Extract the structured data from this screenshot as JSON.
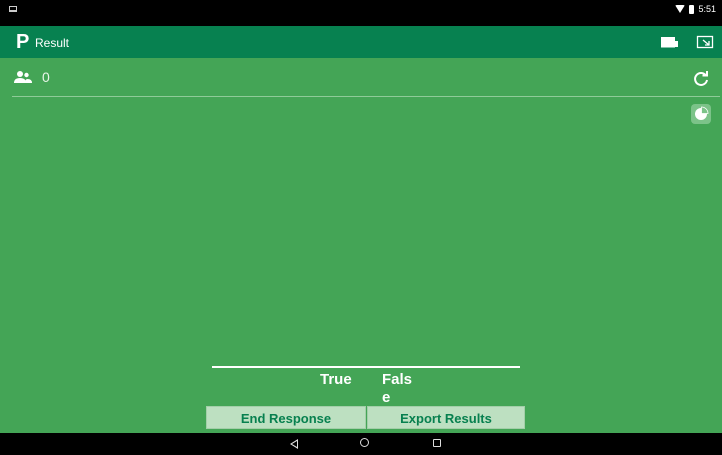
{
  "status_bar": {
    "time": "5:51"
  },
  "app_bar": {
    "logo": "P",
    "title": "Result"
  },
  "summary": {
    "respondent_count": "0"
  },
  "chart_data": {
    "type": "bar",
    "categories": [
      "True",
      "False"
    ],
    "values": [
      0,
      0
    ]
  },
  "actions": {
    "end_response": "End Response",
    "export_results": "Export Results"
  },
  "icons": {
    "appbar_left": "logo",
    "appbar_right": [
      "present-icon",
      "fullscreen-exit-icon"
    ],
    "content": [
      "users-icon",
      "refresh-icon",
      "pie-chart-icon"
    ]
  },
  "colors": {
    "app_bar": "#078150",
    "content": "#44a556",
    "button_bg": "#bde0c1",
    "button_text": "#07804f"
  }
}
